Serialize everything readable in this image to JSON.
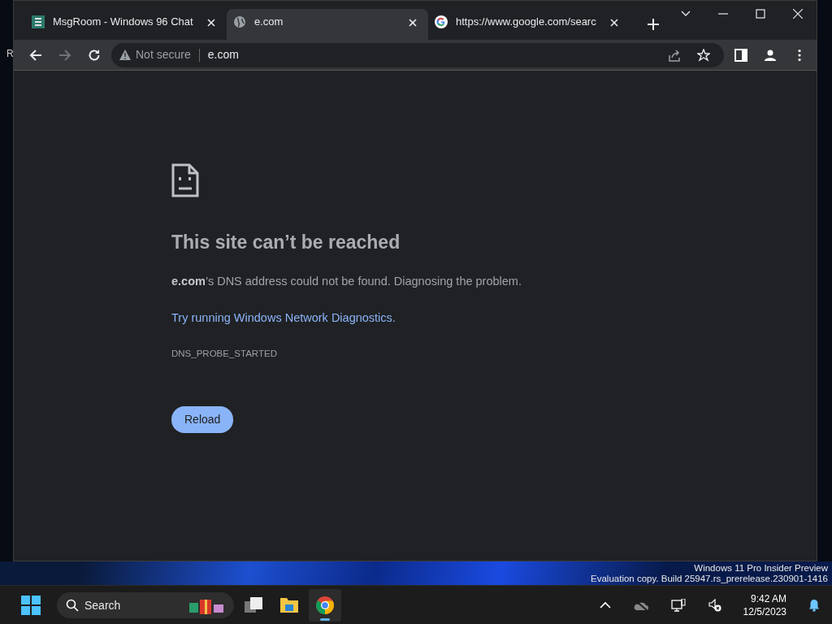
{
  "desktop": {
    "edge_text": "R"
  },
  "tabs": [
    {
      "title": "MsgRoom - Windows 96 Chat",
      "kind": "app",
      "selected": false
    },
    {
      "title": "e.com",
      "kind": "globe",
      "selected": true
    },
    {
      "title": "https://www.google.com/searc",
      "kind": "google",
      "selected": false
    }
  ],
  "toolbar": {
    "nav": [
      {
        "kind": "back",
        "disabled": false
      },
      {
        "kind": "forward",
        "disabled": true
      },
      {
        "kind": "reload",
        "disabled": false
      }
    ],
    "security": "Not secure",
    "url": "e.com"
  },
  "error": {
    "title": "This site can’t be reached",
    "message": "**e.com**’s DNS address could not be found. Diagnosing the problem.",
    "link": "Try running Windows Network Diagnostics.",
    "code": "DNS_PROBE_STARTED",
    "button": "Reload"
  },
  "watermark": [
    "Windows 11 Pro Insider Preview",
    "Evaluation copy. Build 25947.rs_prerelease.230901-1416"
  ],
  "taskbar": {
    "search": {
      "placeholder": "Search"
    },
    "apps": [
      {
        "kind": "taskview",
        "running": false
      },
      {
        "kind": "explorer",
        "running": false
      },
      {
        "kind": "chrome",
        "running": true
      }
    ],
    "clock": {
      "time": "9:42 AM",
      "date": "12/5/2023"
    }
  }
}
